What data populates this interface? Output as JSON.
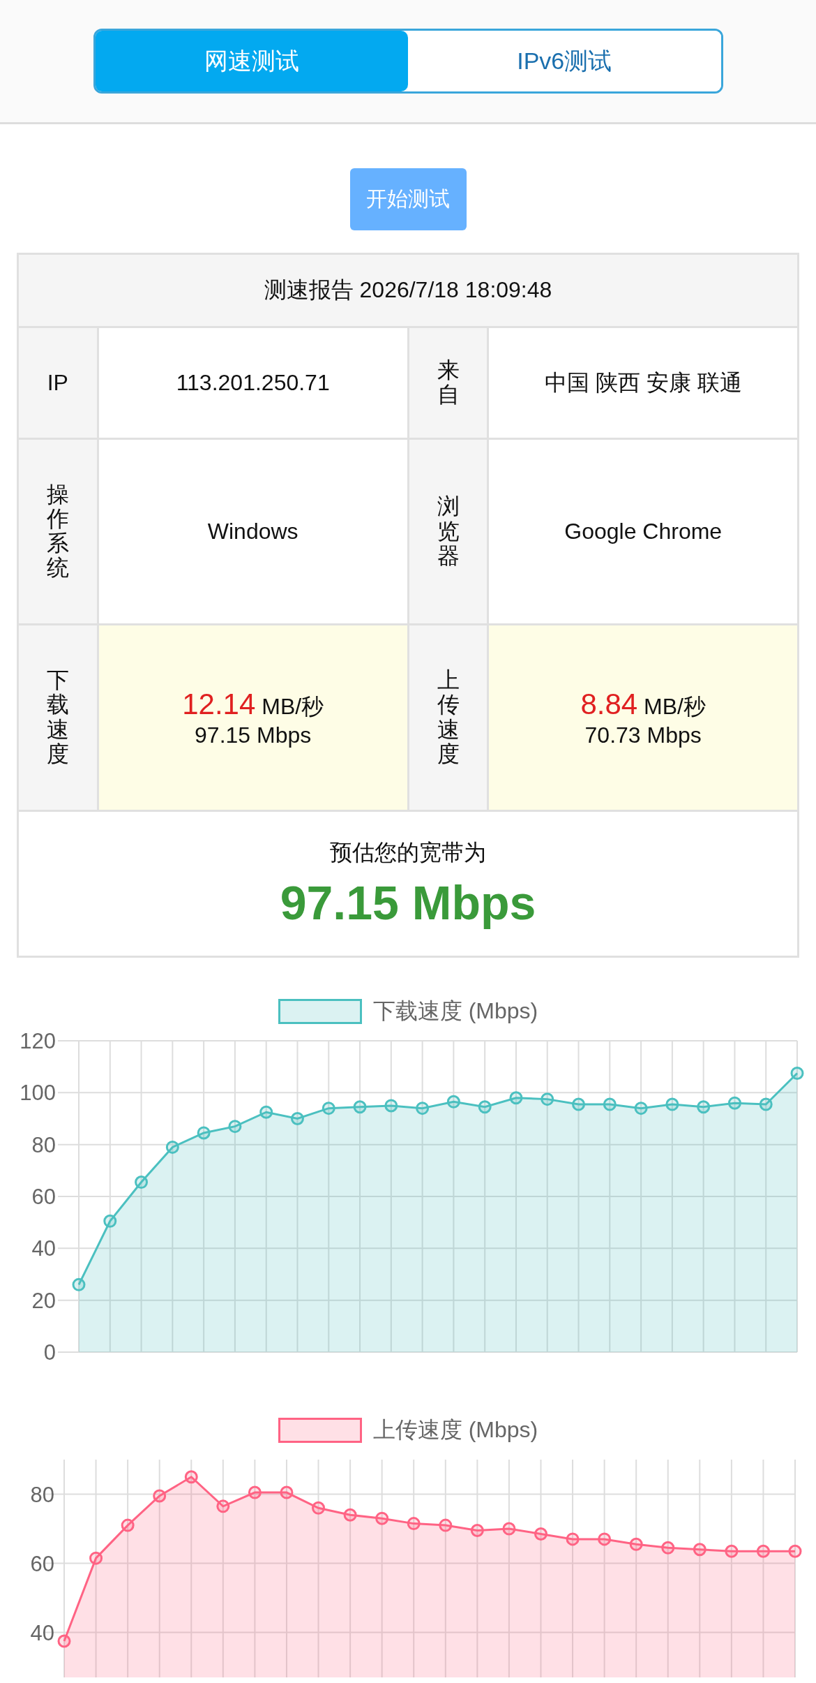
{
  "tabs": [
    {
      "label": "网速测试",
      "selected": true
    },
    {
      "label": "IPv6测试",
      "selected": false
    }
  ],
  "start_button": "开始测试",
  "report": {
    "title": "测速报告 2026/7/18 18:09:48",
    "rows": [
      {
        "kind": "plain",
        "cells": [
          {
            "label": "IP",
            "value": "113.201.250.71"
          },
          {
            "label": "来自",
            "value": "中国 陕西 安康 联通"
          }
        ]
      },
      {
        "kind": "plain",
        "cells": [
          {
            "label": "操作系统",
            "value": "Windows"
          },
          {
            "label": "浏览器",
            "value": "Google Chrome"
          }
        ]
      },
      {
        "kind": "speed",
        "cells": [
          {
            "label": "下载速度",
            "speed": "12.14",
            "unit": "MB/秒",
            "mbps": "97.15 Mbps"
          },
          {
            "label": "上传速度",
            "speed": "8.84",
            "unit": "MB/秒",
            "mbps": "70.73 Mbps"
          }
        ]
      }
    ],
    "estimate": {
      "caption": "预估您的宽带为",
      "value": "97.15 Mbps"
    }
  },
  "charts": [
    {
      "chart_data": {
        "type": "area",
        "grid": true,
        "ylim": [
          0,
          120
        ],
        "yticks": [
          0,
          20,
          40,
          60,
          80,
          100,
          120
        ],
        "series": [
          {
            "name": "下载速度 (Mbps)",
            "color": "#4bc0c0",
            "values": [
              26,
              50.5,
              65.5,
              79,
              84.5,
              87,
              92.5,
              90,
              94,
              94.5,
              95,
              94,
              96.5,
              94.5,
              98,
              97.5,
              95.5,
              95.5,
              94,
              95.5,
              94.5,
              96,
              95.5,
              107.5
            ]
          }
        ]
      }
    },
    {
      "chart_data": {
        "type": "area",
        "grid": true,
        "ylim": [
          27,
          90
        ],
        "yticks": [
          40,
          60,
          80
        ],
        "series": [
          {
            "name": "上传速度 (Mbps)",
            "color": "#ff6384",
            "values": [
              37.5,
              61.5,
              71,
              79.5,
              85,
              76.5,
              80.5,
              80.5,
              76,
              74,
              73,
              71.5,
              71,
              69.5,
              70,
              68.5,
              67,
              67,
              65.5,
              64.5,
              64,
              63.5,
              63.5,
              63.5
            ]
          }
        ]
      }
    }
  ]
}
